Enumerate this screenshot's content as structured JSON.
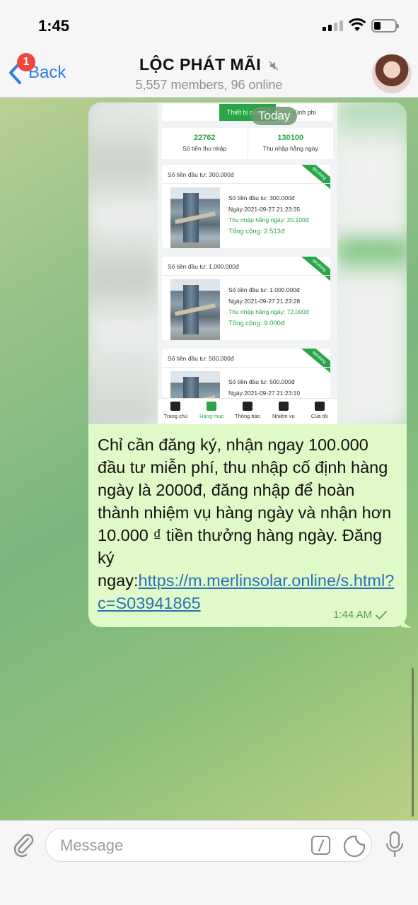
{
  "status_bar": {
    "time": "1:45"
  },
  "header": {
    "back_label": "Back",
    "unread_badge": "1",
    "title": "LỘC PHÁT MÃI",
    "subtitle": "5,557 members, 96 online"
  },
  "message": {
    "date_chip": "Today",
    "screenshot": {
      "tabs": [
        "",
        "Thiết bị của tôi",
        "Kinh phí"
      ],
      "stats": [
        {
          "value": "22762",
          "label": "Số tiền thu nhập"
        },
        {
          "value": "130100",
          "label": "Thu nhập hằng ngày"
        }
      ],
      "cards": [
        {
          "header": "Số tiền đầu tư: 300.000đ",
          "ribbon": "Working",
          "amount": "Số tiền đầu tư: 300.000đ",
          "date": "Ngày:2021-09-27 21:23:35",
          "daily": "Thu nhập hằng ngày: 20.100đ",
          "total": "Tổng cộng: 2.513đ"
        },
        {
          "header": "Số tiền đầu tư: 1.000.000đ",
          "ribbon": "Working",
          "amount": "Số tiền đầu tư: 1.000.000đ",
          "date": "Ngày:2021-09-27 21:23:28",
          "daily": "Thu nhập hằng ngày: 72.000đ",
          "total": "Tổng cộng: 9.000đ"
        },
        {
          "header": "Số tiền đầu tư: 500.000đ",
          "ribbon": "Working",
          "amount": "Số tiền đầu tư: 500.000đ",
          "date": "Ngày:2021-09-27 21:23:10",
          "daily": "",
          "total": ""
        }
      ],
      "nav": [
        "Trang chủ",
        "Hạng mục",
        "Thông báo",
        "Nhiệm vụ",
        "Của tôi"
      ]
    },
    "text": "Chỉ cần đăng ký, nhận ngay 100.000 đầu tư miễn phí, thu nhập cố định hàng ngày là 2000đ, đăng nhập để hoàn thành nhiệm vụ hàng ngày và nhận hơn 10.000 ₫ tiền thưởng hàng ngày. Đăng ký ngay:",
    "link": "https://m.merlinsolar.online/s.html?c=S03941865",
    "time": "1:44 AM"
  },
  "composer": {
    "placeholder": "Message"
  },
  "colors": {
    "accent": "#2b7de0",
    "bubble": "#dff9c8",
    "app_green": "#27a547",
    "link": "#2b6fb8"
  },
  "icons": [
    "signal-icon",
    "wifi-icon",
    "battery-icon",
    "back-chevron-icon",
    "mute-icon",
    "attach-icon",
    "command-icon",
    "sticker-icon",
    "mic-icon",
    "read-check-icon"
  ]
}
